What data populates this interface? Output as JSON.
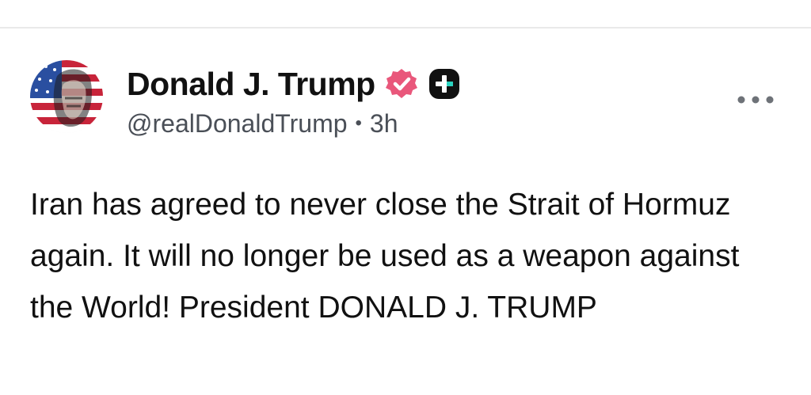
{
  "post": {
    "author": {
      "display_name": "Donald J. Trump",
      "handle": "@realDonaldTrump",
      "avatar_icon": "flag-portrait-avatar",
      "verified_icon": "verified-badge-icon",
      "plus_icon": "plus-badge-icon"
    },
    "separator": "•",
    "time_ago": "3h",
    "more_icon": "more-options-icon",
    "text": "Iran has agreed to never close the Strait of Hormuz again. It will no longer be used as a weapon against the World! President DONALD J. TRUMP"
  },
  "colors": {
    "text_primary": "#111111",
    "text_secondary": "#4a4f57",
    "verified_badge": "#e9577b",
    "plus_badge": "#111111",
    "divider": "#e9e9e9"
  }
}
